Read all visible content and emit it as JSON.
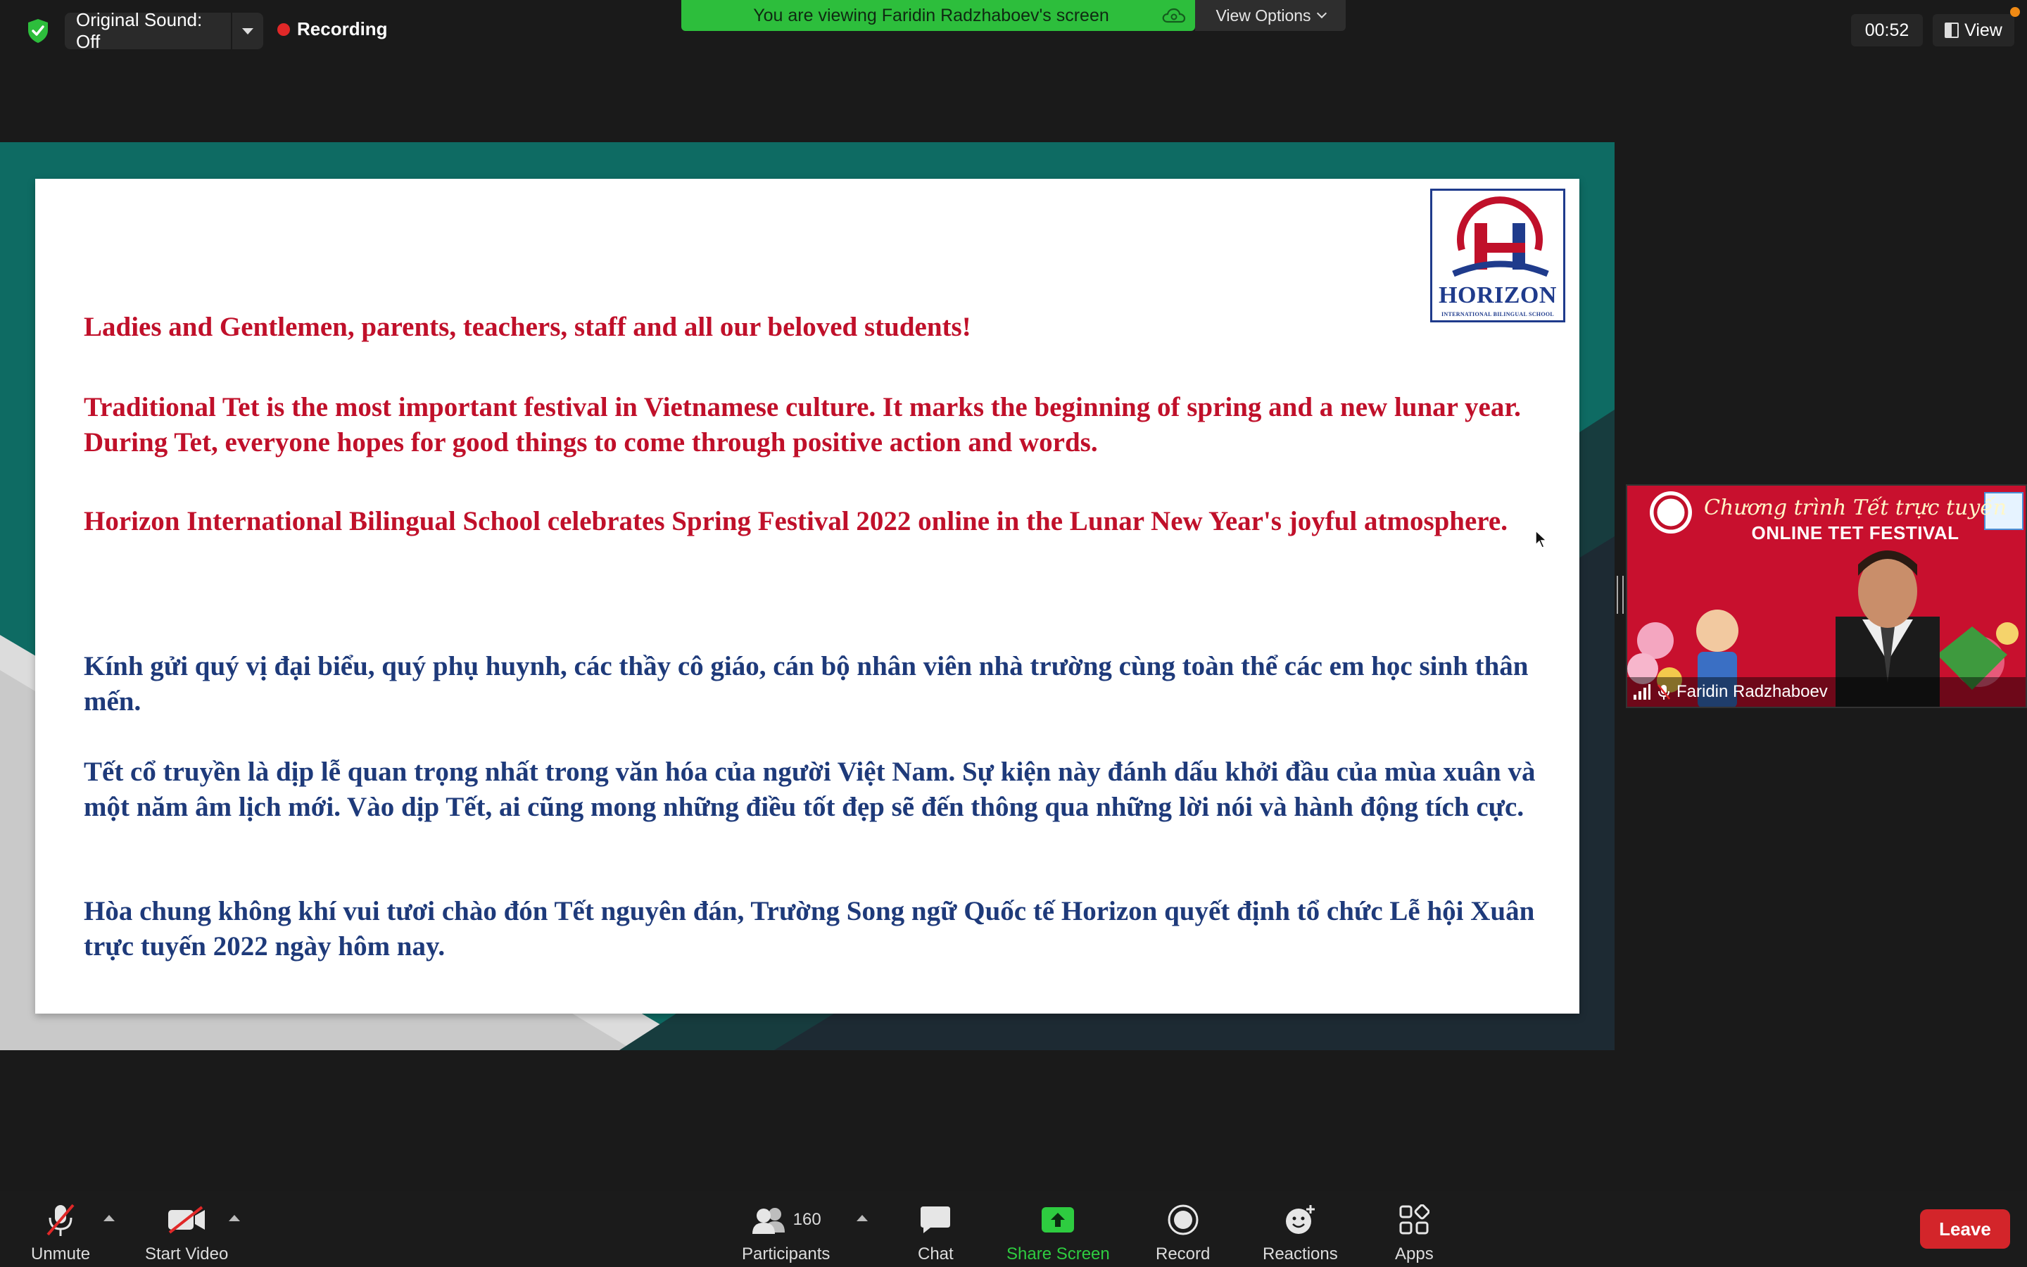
{
  "topbar": {
    "original_sound": "Original Sound: Off",
    "recording": "Recording",
    "viewing_banner": "You are viewing Faridin Radzhaboev's screen",
    "view_options": "View Options",
    "timer": "00:52",
    "view": "View"
  },
  "slide": {
    "logo_text": "HORIZON",
    "logo_subtext": "INTERNATIONAL BILINGUAL SCHOOL",
    "en_greeting": "Ladies and Gentlemen, parents, teachers, staff and all our beloved students!",
    "en_para1": "Traditional Tet is the most important festival in Vietnamese culture. It marks the beginning of spring and a new lunar year. During Tet, everyone hopes for good things to come through positive action and words.",
    "en_para2": "Horizon International Bilingual School celebrates Spring Festival 2022 online in the Lunar New Year's joyful atmosphere.",
    "vi_greeting": "Kính gửi quý vị đại biểu, quý phụ huynh, các thầy cô giáo, cán bộ nhân viên nhà trường cùng toàn thể các em học sinh thân mến.",
    "vi_para1": "Tết cổ truyền là dịp lễ quan trọng nhất trong văn hóa của người Việt Nam. Sự kiện này đánh dấu khởi đầu của mùa xuân và một năm âm lịch mới. Vào dịp Tết, ai cũng mong những điều tốt đẹp sẽ đến thông qua những lời nói và hành động tích cực.",
    "vi_para2": "Hòa chung không khí vui tươi chào đón Tết nguyên đán, Trường Song ngữ Quốc tế Horizon quyết định tổ chức Lễ hội Xuân trực tuyến 2022 ngày hôm nay."
  },
  "participant_tile": {
    "banner_line1": "Chương trình Tết trực tuyến",
    "banner_line2": "ONLINE TET FESTIVAL",
    "name": "Faridin Radzhaboev"
  },
  "toolbar": {
    "unmute": "Unmute",
    "start_video": "Start Video",
    "participants_count": "160",
    "participants": "Participants",
    "chat": "Chat",
    "share_screen": "Share Screen",
    "record": "Record",
    "reactions": "Reactions",
    "apps": "Apps",
    "leave": "Leave"
  },
  "colors": {
    "share_green": "#2ecc40",
    "leave_red": "#d3252a",
    "slide_red_text": "#c0102a",
    "slide_blue_text": "#1e3a7a",
    "banner_green": "#2dbe3c"
  }
}
